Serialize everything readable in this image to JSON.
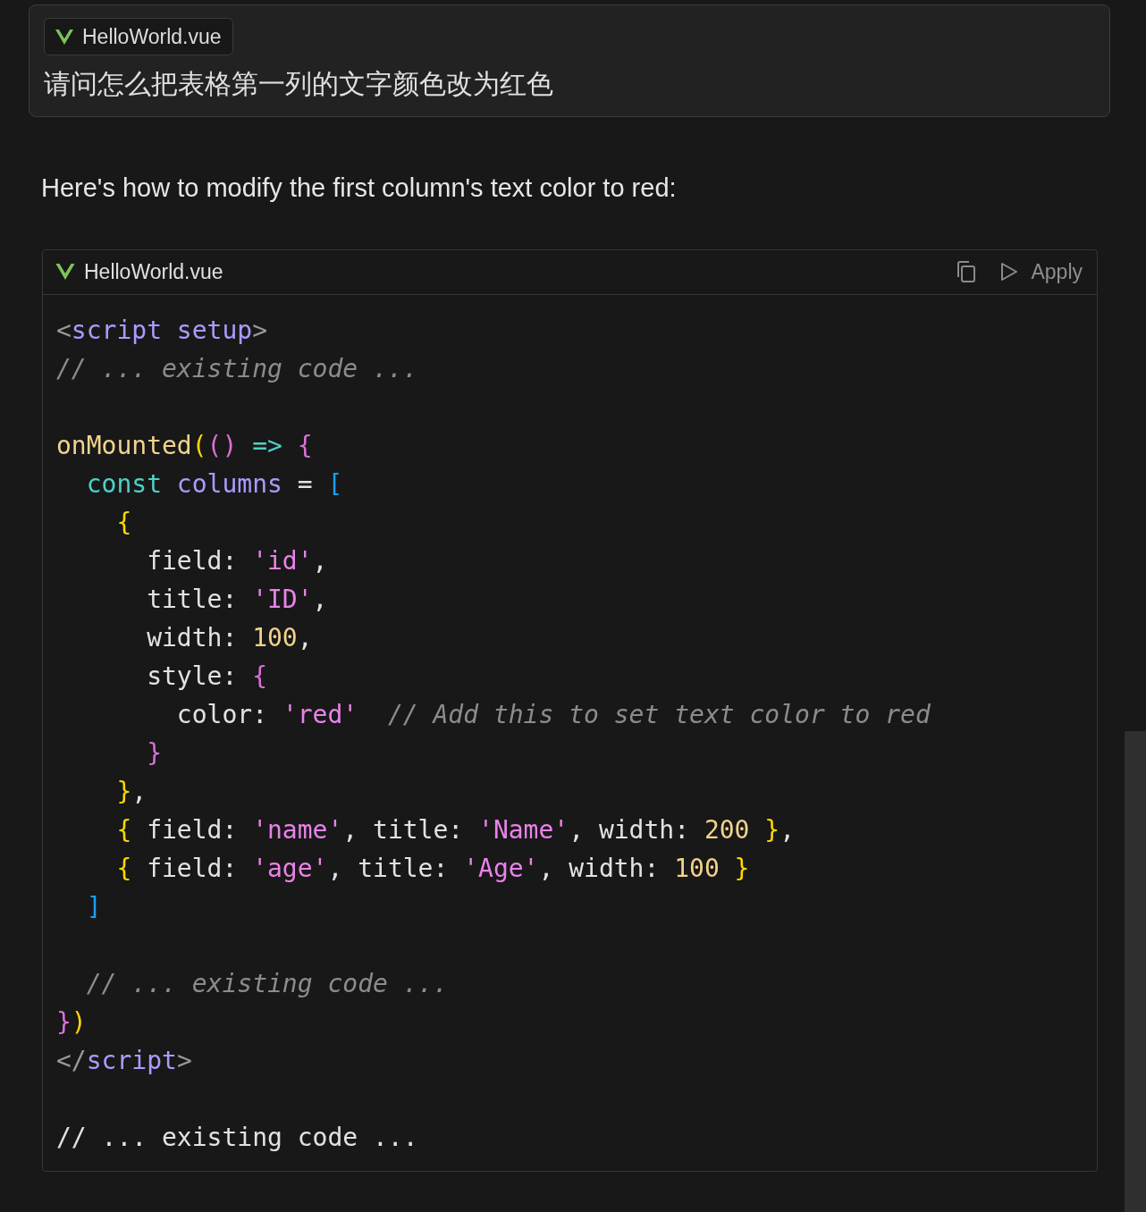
{
  "question_card": {
    "file_chip": "HelloWorld.vue",
    "question": "请问怎么把表格第一列的文字颜色改为红色"
  },
  "answer": {
    "intro": "Here's how to modify the first column's text color to red:",
    "code_block": {
      "filename": "HelloWorld.vue",
      "apply_label": "Apply",
      "lines": [
        {
          "kind": "code",
          "tokens": [
            {
              "kind": "punct",
              "text": "<"
            },
            {
              "kind": "tag",
              "text": "script"
            },
            {
              "kind": "tag",
              "text": " setup"
            },
            {
              "kind": "punct",
              "text": ">"
            }
          ]
        },
        {
          "kind": "code",
          "tokens": [
            {
              "kind": "comment",
              "text": "// ... existing code ..."
            }
          ]
        },
        {
          "kind": "blank"
        },
        {
          "kind": "code",
          "tokens": [
            {
              "kind": "func",
              "text": "onMounted"
            },
            {
              "kind": "bracket1",
              "text": "("
            },
            {
              "kind": "bracket2",
              "text": "()"
            },
            {
              "kind": "keyword",
              "text": " =>"
            },
            {
              "kind": "bracket2",
              "text": " {"
            }
          ]
        },
        {
          "kind": "code",
          "tokens": [
            {
              "kind": "keyword",
              "text": "  const"
            },
            {
              "kind": "variable",
              "text": " columns"
            },
            {
              "kind": "plain",
              "text": " = "
            },
            {
              "kind": "bracket3",
              "text": "["
            }
          ]
        },
        {
          "kind": "code",
          "tokens": [
            {
              "kind": "bracket1",
              "text": "    {"
            }
          ]
        },
        {
          "kind": "code",
          "tokens": [
            {
              "kind": "plain",
              "text": "      field: "
            },
            {
              "kind": "string",
              "text": "'id'"
            },
            {
              "kind": "plain",
              "text": ","
            }
          ]
        },
        {
          "kind": "code",
          "tokens": [
            {
              "kind": "plain",
              "text": "      title: "
            },
            {
              "kind": "string",
              "text": "'ID'"
            },
            {
              "kind": "plain",
              "text": ","
            }
          ]
        },
        {
          "kind": "code",
          "tokens": [
            {
              "kind": "plain",
              "text": "      width: "
            },
            {
              "kind": "number",
              "text": "100"
            },
            {
              "kind": "plain",
              "text": ","
            }
          ]
        },
        {
          "kind": "code",
          "tokens": [
            {
              "kind": "plain",
              "text": "      style: "
            },
            {
              "kind": "bracket2",
              "text": "{"
            }
          ]
        },
        {
          "kind": "code",
          "tokens": [
            {
              "kind": "plain",
              "text": "        color: "
            },
            {
              "kind": "string",
              "text": "'red'"
            },
            {
              "kind": "comment",
              "text": "  // Add this to set text color to red"
            }
          ]
        },
        {
          "kind": "code",
          "tokens": [
            {
              "kind": "bracket2",
              "text": "      }"
            }
          ]
        },
        {
          "kind": "code",
          "tokens": [
            {
              "kind": "bracket1",
              "text": "    }"
            },
            {
              "kind": "plain",
              "text": ","
            }
          ]
        },
        {
          "kind": "code",
          "tokens": [
            {
              "kind": "bracket1",
              "text": "    {"
            },
            {
              "kind": "plain",
              "text": " field: "
            },
            {
              "kind": "string",
              "text": "'name'"
            },
            {
              "kind": "plain",
              "text": ", title: "
            },
            {
              "kind": "string",
              "text": "'Name'"
            },
            {
              "kind": "plain",
              "text": ", width: "
            },
            {
              "kind": "number",
              "text": "200"
            },
            {
              "kind": "bracket1",
              "text": " }"
            },
            {
              "kind": "plain",
              "text": ","
            }
          ]
        },
        {
          "kind": "code",
          "tokens": [
            {
              "kind": "bracket1",
              "text": "    {"
            },
            {
              "kind": "plain",
              "text": " field: "
            },
            {
              "kind": "string",
              "text": "'age'"
            },
            {
              "kind": "plain",
              "text": ", title: "
            },
            {
              "kind": "string",
              "text": "'Age'"
            },
            {
              "kind": "plain",
              "text": ", width: "
            },
            {
              "kind": "number",
              "text": "100"
            },
            {
              "kind": "bracket1",
              "text": " }"
            }
          ]
        },
        {
          "kind": "code",
          "tokens": [
            {
              "kind": "bracket3",
              "text": "  ]"
            }
          ]
        },
        {
          "kind": "blank"
        },
        {
          "kind": "code",
          "tokens": [
            {
              "kind": "comment",
              "text": "  // ... existing code ..."
            }
          ]
        },
        {
          "kind": "code",
          "tokens": [
            {
              "kind": "bracket2",
              "text": "}"
            },
            {
              "kind": "bracket1",
              "text": ")"
            }
          ]
        },
        {
          "kind": "code",
          "tokens": [
            {
              "kind": "punct",
              "text": "</"
            },
            {
              "kind": "tag",
              "text": "script"
            },
            {
              "kind": "punct",
              "text": ">"
            }
          ]
        },
        {
          "kind": "blank"
        },
        {
          "kind": "code",
          "tokens": [
            {
              "kind": "plain",
              "text": "// ... existing code ..."
            }
          ]
        }
      ]
    }
  }
}
